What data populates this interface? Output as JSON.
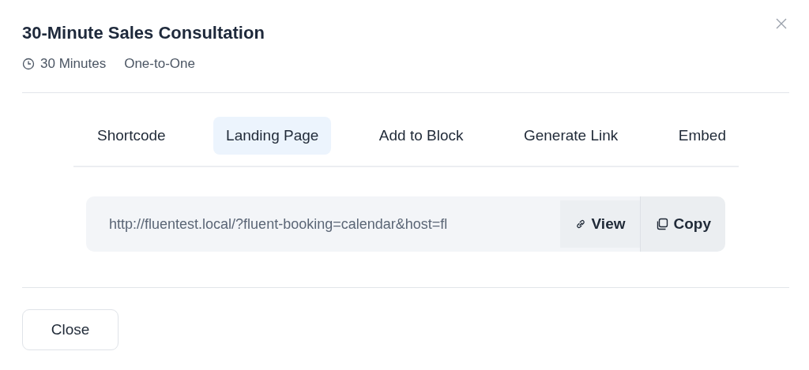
{
  "dialog": {
    "title": "30-Minute Sales Consultation",
    "duration": "30 Minutes",
    "type": "One-to-One"
  },
  "tabs": [
    {
      "label": "Shortcode",
      "selected": false
    },
    {
      "label": "Landing Page",
      "selected": true
    },
    {
      "label": "Add to Block",
      "selected": false
    },
    {
      "label": "Generate Link",
      "selected": false
    },
    {
      "label": "Embed",
      "selected": false
    }
  ],
  "link": {
    "value": "http://fluentest.local/?fluent-booking=calendar&host=fl",
    "view_label": "View",
    "copy_label": "Copy"
  },
  "footer": {
    "close_label": "Close"
  }
}
